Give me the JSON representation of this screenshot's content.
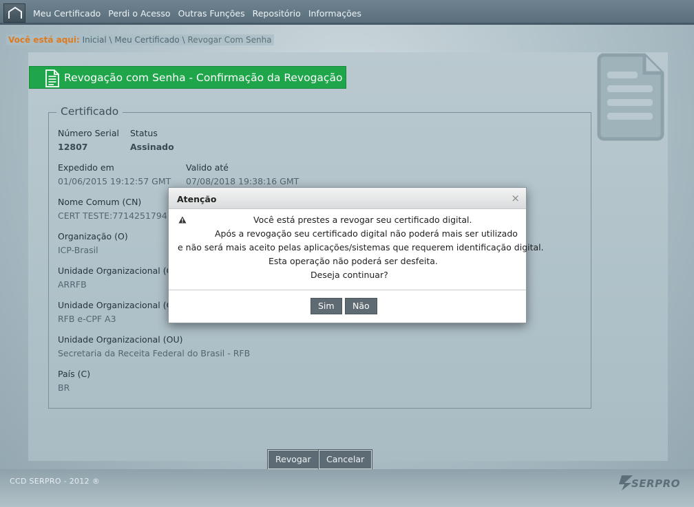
{
  "nav": {
    "items": [
      "Meu Certificado",
      "Perdi o Acesso",
      "Outras Funções",
      "Repositório",
      "Informações"
    ]
  },
  "breadcrumb": {
    "label": "Você está aqui:",
    "home": "Inicial",
    "sep": "\\",
    "section": "Meu Certificado",
    "current": "Revogar Com Senha"
  },
  "page": {
    "title": "Revogação com Senha - Confirmação da Revogação",
    "accent_color": "#1fa64a"
  },
  "certificate": {
    "legend": "Certificado",
    "serial_label": "Número Serial",
    "serial_value": "12807",
    "status_label": "Status",
    "status_value": "Assinado",
    "issued_label": "Expedido em",
    "issued_value": "01/06/2015 19:12:57 GMT",
    "valid_label": "Valido até",
    "valid_value": "07/08/2018 19:38:16 GMT",
    "cn_label": "Nome Comum (CN)",
    "cn_value": "CERT TESTE:7714251794",
    "org_label": "Organização (O)",
    "org_value": "ICP-Brasil",
    "ou1_label": "Unidade Organizacional (OU",
    "ou1_value": "ARRFB",
    "ou2_label": "Unidade Organizacional (OU",
    "ou2_value": "RFB e-CPF A3",
    "ou3_label": "Unidade Organizacional (OU)",
    "ou3_value": "Secretaria da Receita Federal do Brasil - RFB",
    "country_label": "País (C)",
    "country_value": "BR"
  },
  "actions": {
    "revoke": "Revogar",
    "cancel": "Cancelar"
  },
  "footer": {
    "copyright": "CCD SERPRO - 2012 ®",
    "brand": "SERPRO"
  },
  "dialog": {
    "title": "Atenção",
    "close": "×",
    "lines": [
      "Você está prestes a revogar seu certificado digital.",
      "Após a revogação seu certificado digital não poderá mais ser utilizado",
      "e não será mais aceito pelas aplicações/sistemas que requerem identificação digital.",
      "Esta operação não poderá ser desfeita.",
      "Deseja continuar?"
    ],
    "yes": "Sim",
    "no": "Não"
  }
}
